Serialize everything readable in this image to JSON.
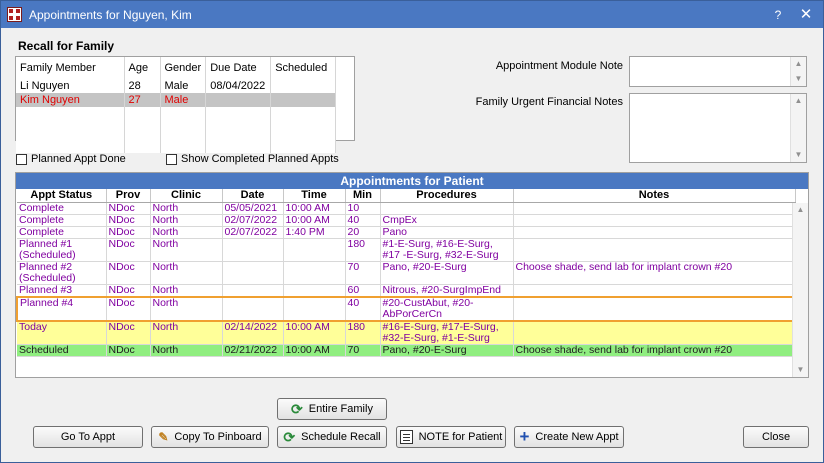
{
  "window": {
    "title": "Appointments for Nguyen, Kim",
    "help": "?",
    "close": "✕"
  },
  "recall": {
    "title": "Recall for Family",
    "columns": [
      "Family Member",
      "Age",
      "Gender",
      "Due Date",
      "Scheduled"
    ],
    "rows": [
      [
        "Li Nguyen",
        "28",
        "Male",
        "08/04/2022",
        ""
      ],
      [
        "Kim Nguyen",
        "27",
        "Male",
        "",
        ""
      ]
    ]
  },
  "checkboxes": {
    "planned_done": "Planned Appt Done",
    "show_completed": "Show Completed Planned Appts"
  },
  "notes": {
    "module_note_label": "Appointment Module Note",
    "urgent_label": "Family Urgent Financial Notes"
  },
  "appointments": {
    "title": "Appointments for Patient",
    "columns": [
      "Appt Status",
      "Prov",
      "Clinic",
      "Date",
      "Time",
      "Min",
      "Procedures",
      "Notes"
    ],
    "rows": [
      [
        "Complete",
        "NDoc",
        "North",
        "05/05/2021",
        "10:00 AM",
        "10",
        "",
        ""
      ],
      [
        "Complete",
        "NDoc",
        "North",
        "02/07/2022",
        "10:00 AM",
        "40",
        "CmpEx",
        ""
      ],
      [
        "Complete",
        "NDoc",
        "North",
        "02/07/2022",
        "1:40 PM",
        "20",
        "Pano",
        ""
      ],
      [
        "Planned #1 (Scheduled)",
        "NDoc",
        "North",
        "",
        "",
        "180",
        "#1-E-Surg, #16-E-Surg, #17 -E-Surg, #32-E-Surg",
        ""
      ],
      [
        "Planned #2 (Scheduled)",
        "NDoc",
        "North",
        "",
        "",
        "70",
        "Pano, #20-E-Surg",
        "Choose shade, send lab for implant crown #20"
      ],
      [
        "Planned #3",
        "NDoc",
        "North",
        "",
        "",
        "60",
        "Nitrous, #20-SurgImpEnd",
        ""
      ],
      [
        "Planned #4",
        "NDoc",
        "North",
        "",
        "",
        "40",
        "#20-CustAbut, #20- AbPorCerCn",
        ""
      ],
      [
        "Today",
        "NDoc",
        "North",
        "02/14/2022",
        "10:00 AM",
        "180",
        "#16-E-Surg, #17-E-Surg, #32-E-Surg, #1-E-Surg",
        ""
      ],
      [
        "Scheduled",
        "NDoc",
        "North",
        "02/21/2022",
        "10:00 AM",
        "70",
        "Pano, #20-E-Surg",
        "Choose shade, send lab for implant crown #20"
      ]
    ]
  },
  "buttons": {
    "entire_family": "Entire Family",
    "go_to_appt": "Go To Appt",
    "copy_pinboard": "Copy To Pinboard",
    "schedule_recall": "Schedule Recall",
    "note_patient": "NOTE for Patient",
    "create_new": "Create New Appt",
    "close": "Close"
  },
  "icons": {
    "refresh": "refresh-icon",
    "pin": "pinboard-icon",
    "note": "note-icon",
    "plus": "plus-icon"
  }
}
